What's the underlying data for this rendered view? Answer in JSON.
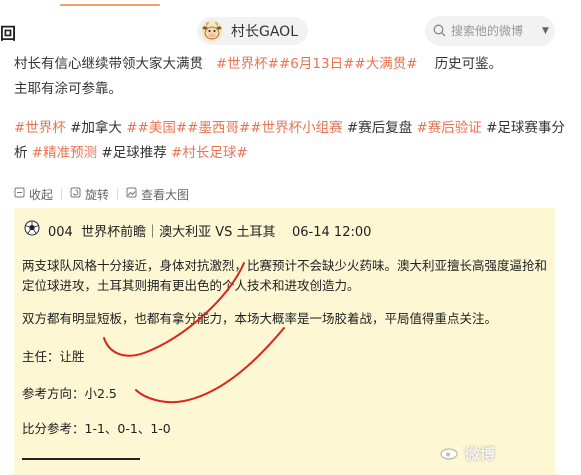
{
  "header": {
    "back_glyph": "回",
    "username": "村长GAOL",
    "avatar_icon": "cow-avatar-icon",
    "search_placeholder": "搜索他的微博",
    "accent_color": "#eb7350"
  },
  "post": {
    "intro_text": "村长有信心继续带领大家大满贯",
    "intro_tag": "#世界杯##6月13日##大满贯#",
    "intro_suffix": "历史可鉴。",
    "line2": "主耶有涂可参靠。",
    "tags_line": [
      {
        "text": "#世界杯",
        "tag": true
      },
      {
        "text": "#加拿大",
        "tag": false
      },
      {
        "text": "##美国##墨西哥##世界杯小组赛",
        "tag": true
      },
      {
        "text": "#赛后复盘",
        "tag": false
      },
      {
        "text": "#赛后验证",
        "tag": true
      },
      {
        "text": "#足球赛事分析",
        "tag": false
      },
      {
        "text": "#精准预测",
        "tag": true
      },
      {
        "text": "#足球推荐",
        "tag": false
      },
      {
        "text": "#村长足球#",
        "tag": true
      }
    ]
  },
  "actions": {
    "collapse_label": "收起",
    "rotate_label": "旋转",
    "view_large_label": "查看大图"
  },
  "card": {
    "header_text": "004  世界杯前瞻｜澳大利亚 VS 土耳其    06-14 12:00",
    "para1": "两支球队风格十分接近，身体对抗激烈，比赛预计不会缺少火药味。澳大利亚擅长高强度逼抢和定位球进攻，土耳其则拥有更出色的个人技术和进攻创造力。",
    "para2": "双方都有明显短板，也都有拿分能力，本场大概率是一场胶着战，平局值得重点关注。",
    "main_pick": "主任：让胜",
    "direction": "参考方向：小2.5",
    "score_ref": "比分参考：1-1、0-1、1-0",
    "ball_icon": "soccer-ball-icon"
  },
  "watermark": "微博"
}
